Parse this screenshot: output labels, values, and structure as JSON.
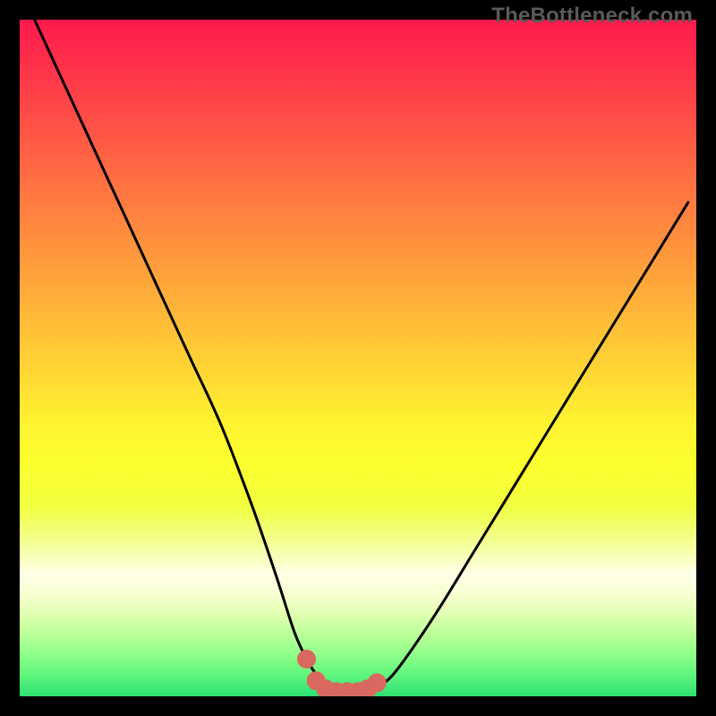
{
  "watermark": "TheBottleneck.com",
  "colors": {
    "frame": "#000000",
    "curve_stroke": "#000000",
    "marker_fill": "#d9685e",
    "marker_stroke": "#d9685e"
  },
  "chart_data": {
    "type": "line",
    "title": "",
    "xlabel": "",
    "ylabel": "",
    "xlim": [
      0,
      100
    ],
    "ylim": [
      0,
      100
    ],
    "grid": false,
    "legend": false,
    "series": [
      {
        "name": "bottleneck-curve",
        "x_pct": [
          2.2,
          6.8,
          11.4,
          16.0,
          20.6,
          25.2,
          29.8,
          34.4,
          38.0,
          40.6,
          42.4,
          44.0,
          45.6,
          47.2,
          49.0,
          51.0,
          52.8,
          55.0,
          58.0,
          62.0,
          66.6,
          71.2,
          75.8,
          80.4,
          85.0,
          89.6,
          94.2,
          98.8
        ],
        "y_pct": [
          100.0,
          90.0,
          80.0,
          70.0,
          60.0,
          50.0,
          40.0,
          28.0,
          17.5,
          9.5,
          5.5,
          3.0,
          1.3,
          0.7,
          0.7,
          0.7,
          1.3,
          3.0,
          7.0,
          13.0,
          20.5,
          28.0,
          35.5,
          43.0,
          50.5,
          58.0,
          65.5,
          73.0
        ]
      }
    ],
    "markers": {
      "name": "flat-region",
      "x_pct": [
        42.4,
        43.8,
        45.2,
        46.8,
        48.4,
        50.0,
        51.4,
        52.8
      ],
      "y_pct": [
        5.5,
        2.3,
        1.1,
        0.7,
        0.7,
        0.7,
        1.1,
        2.0
      ],
      "radius_px": 10
    }
  }
}
